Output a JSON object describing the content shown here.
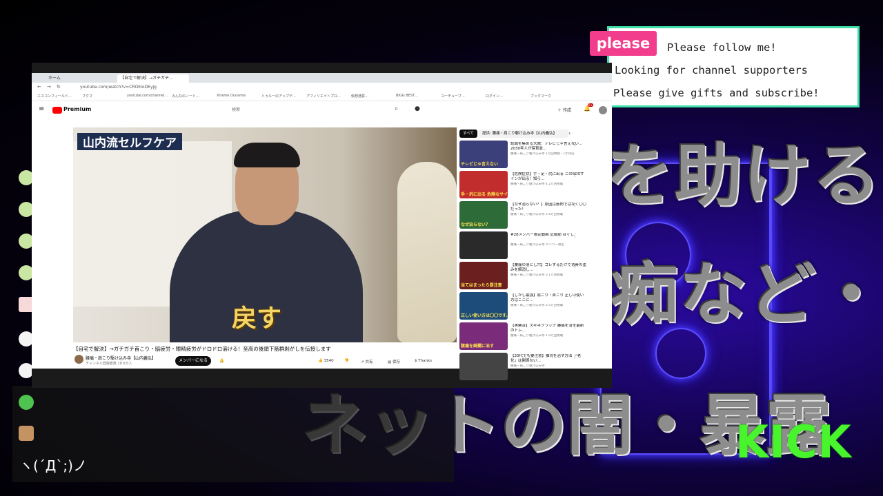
{
  "overlay": {
    "please_badge": "please",
    "follow_lines": [
      "Please follow me!",
      "Looking for channel supporters",
      "Please give gifts and subscribe!"
    ],
    "background_text": [
      "を助ける",
      "痴など・・・",
      "ネットの闇・暴露"
    ],
    "kick_logo": "KICK",
    "kaomoji": "ヽ(´Д`;)ノ",
    "accent_green": "#48f52d",
    "accent_pink": "#f23d8c",
    "neon_blue": "#5b4dff"
  },
  "browser": {
    "tabs": [
      "ホーム",
      "【自宅で解決】→ガチガチ…"
    ],
    "url": "youtube.com/watch?v=CROEIoDEyjg",
    "bookmarks": [
      "エスコンフィールド…",
      "ブクマ",
      "youtube.com/channel…",
      "みんなのノート…",
      "Xtreme Dunamis",
      "トゥルーのアップデ…",
      "アフィリエイトプロ…",
      "仮想通貨…",
      "BIGG BEST…",
      "ユーチューブ…",
      "ログイン…",
      "ブックマーク"
    ]
  },
  "youtube": {
    "logo": "Premium",
    "search_placeholder": "検索",
    "create_label": "作成",
    "notification_count": "9+",
    "video": {
      "overlay_title": "山内流セルフケア",
      "caption": "戻す",
      "title": "【自宅で解決】→ガチガチ首こり・脳疲労・眼精疲労がドロドロ溶ける！至高の後頭下筋群剥がしを伝授します",
      "channel": "腰痛・肩こり駆け込み寺【山内義弘】",
      "subscribers": "チャンネル登録者数 18.6万人",
      "member_button": "メンバーになる",
      "likes": "3540",
      "share": "共有",
      "save": "保存",
      "thanks": "Thanks"
    },
    "chips": [
      "すべて",
      "提供: 腰痛・肩こり駆け込み寺【山内義弘】"
    ],
    "recommendations": [
      {
        "title": "認識を集める大敵：テレビじゃ言えない…2030年人が保育並…",
        "meta": "腰痛・肩こり駆け込み寺 1万回視聴・1か月前",
        "thumb_text": "テレビじゃ言えない"
      },
      {
        "title": "【危険症状】手・足・尻に出る このSOSサインが出る！知ら…",
        "meta": "腰痛・肩こり駆け込み寺 4.2万回視聴",
        "thumb_text": "手・尻に出る 危険なサイン"
      },
      {
        "title": "【なぜ治らない？】原因は筋肉ではなく〇〇だった！",
        "meta": "腰痛・肩こり駆け込み寺 2.8万回視聴",
        "thumb_text": "なぜ治らない？"
      },
      {
        "title": "#28メンバー限定動画 広頸筋 ほぐし",
        "meta": "腰痛・肩こり駆け込み寺 メンバー限定",
        "thumb_text": ""
      },
      {
        "title": "【腰痛の落とし穴】コレするだけで背骨の歪みを解消し…",
        "meta": "腰痛・肩こり駆け込み寺 3.1万回視聴",
        "thumb_text": "当てはまったら要注意"
      },
      {
        "title": "【しかし最強】肩こり・首こり 正しい使い方はここに…",
        "meta": "腰痛・肩こり駆け込み寺 2.5万回視聴",
        "thumb_text": "正しい使い方は〇〇です。"
      },
      {
        "title": "【実験済】スキネクラップ 腰痛を治す最新のトレ…",
        "meta": "腰痛・肩こり駆け込み寺 1.9万回視聴",
        "thumb_text": "腰痛を綺麗に治す"
      },
      {
        "title": "【20代でも要注意】猫背を治す方法 「老化」は関係ない…",
        "meta": "腰痛・肩こり駆け込み寺",
        "thumb_text": ""
      }
    ]
  }
}
